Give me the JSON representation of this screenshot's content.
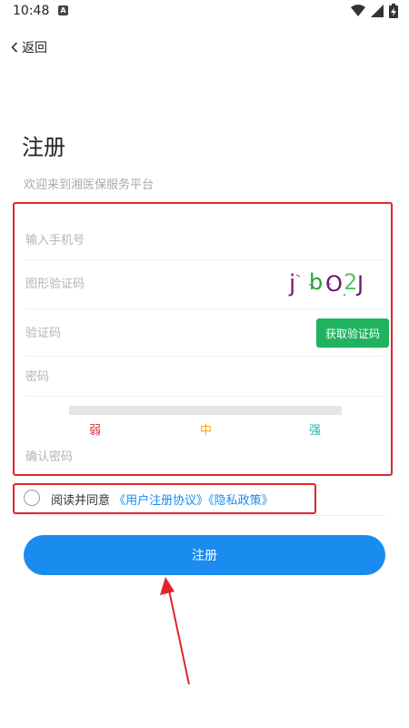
{
  "status_bar": {
    "time": "10:48",
    "notification_icon": "a-icon"
  },
  "back": {
    "label": "返回"
  },
  "title": "注册",
  "subtitle": "欢迎来到湘医保服务平台",
  "form": {
    "phone_placeholder": "输入手机号",
    "captcha_placeholder": "图形验证码",
    "captcha_chars": [
      "j",
      "b",
      "O",
      "2",
      "J"
    ],
    "code_placeholder": "验证码",
    "get_code_label": "获取验证码",
    "password_placeholder": "密码",
    "strength_labels": [
      "弱",
      "中",
      "强"
    ],
    "confirm_placeholder": "确认密码"
  },
  "agreement": {
    "prefix": "阅读并同意",
    "user_agreement": "《用户注册协议》",
    "privacy_policy": "《隐私政策》"
  },
  "register_label": "注册",
  "colors": {
    "primary": "#1a8cf0",
    "get_code": "#1fb35f",
    "annotation": "#e0262b",
    "weak": "#e0262b",
    "medium": "#f5a623",
    "strong": "#1fb3a6"
  }
}
